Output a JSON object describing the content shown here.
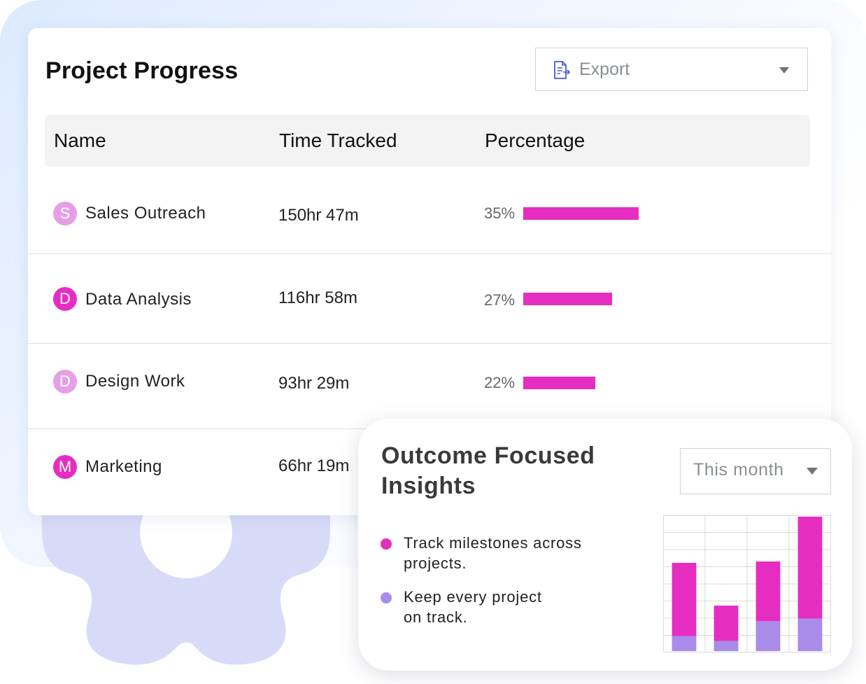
{
  "project_progress": {
    "title": "Project Progress",
    "export": {
      "label": "Export",
      "icon": "export-document-icon"
    },
    "headers": {
      "name": "Name",
      "time": "Time Tracked",
      "percentage": "Percentage"
    },
    "rows": [
      {
        "initial": "S",
        "name": "Sales Outreach",
        "time": "150hr 47m",
        "pct_label": "35%",
        "pct": 35,
        "avatar_color": "#e69ee6"
      },
      {
        "initial": "D",
        "name": "Data Analysis",
        "time": "116hr 58m",
        "pct_label": "27%",
        "pct": 27,
        "avatar_color": "#e52ec1"
      },
      {
        "initial": "D",
        "name": "Design Work",
        "time": "93hr 29m",
        "pct_label": "22%",
        "pct": 22,
        "avatar_color": "#e69ee6"
      },
      {
        "initial": "M",
        "name": "Marketing",
        "time": "66hr 19m",
        "avatar_color": "#e52ec1"
      }
    ],
    "bar_color": "#e52ec1"
  },
  "insights": {
    "title": "Outcome Focused Insights",
    "period": "This month",
    "bullets": [
      {
        "text": "Track milestones across projects.",
        "color": "#e52ec1"
      },
      {
        "text": "Keep every project on track.",
        "color": "#a98bea"
      }
    ]
  },
  "chart_data": {
    "type": "bar",
    "stacked": true,
    "categories": [
      "",
      "",
      "",
      ""
    ],
    "series": [
      {
        "values": [
          22,
          15,
          44,
          48
        ],
        "color": "#a98bea"
      },
      {
        "values": [
          108,
          52,
          88,
          150
        ],
        "color": "#e52ec1"
      }
    ],
    "ylim": [
      0,
      198
    ],
    "grid": true
  }
}
